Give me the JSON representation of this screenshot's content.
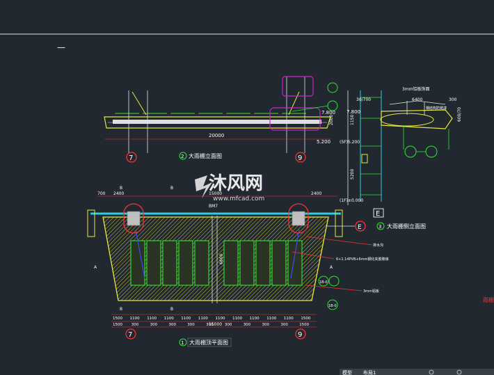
{
  "header": {
    "cursor_mark": "—"
  },
  "plan_view": {
    "caption_number": "1",
    "caption": "大雨棚顶平面图",
    "axis_left": "7",
    "axis_right": "9",
    "dim_left_top": "700",
    "dim_left_top2": "2400",
    "dim_center_top": "15000",
    "dim_right_top": "2400",
    "section_mark_b": "B",
    "section_mark_a": "A",
    "beam_label": "BM7",
    "dims_bottom": [
      "1500",
      "1100",
      "1100",
      "1100",
      "1100",
      "1100",
      "1100",
      "1100",
      "1100",
      "1100",
      "1100",
      "1500"
    ],
    "dims_bottom2": [
      "1500",
      "300",
      "300",
      "300",
      "300",
      "300",
      "300",
      "300",
      "300",
      "300",
      "1500"
    ],
    "total_bottom": "15000",
    "note_glass": "6+1.14PVB+6mm钢化夹胶玻璃",
    "note_panel": "3mm铝板",
    "note_drain": "排水沟",
    "red_note": "雨棚",
    "dim_height": "6600",
    "callout_top": "1B-0",
    "callout_bottom": "1B-0"
  },
  "elevation_view": {
    "caption_number": "2",
    "caption": "大雨棚立面图",
    "axis_left": "7",
    "axis_right": "9",
    "dim_total": "20000",
    "level_top": "7.800",
    "level_bottom": "5.200",
    "dim_side": "2000"
  },
  "side_view": {
    "caption_number": "3",
    "caption": "大雨棚侧立面图",
    "axis": "E",
    "level_top": "7.800",
    "level_mid": "(5F)5.200",
    "level_bottom": "(1F)±0.000",
    "note_top": "3mm铝板饰面",
    "note_mid": "钢结构防锈漆",
    "dim_a": "6400",
    "dim_b": "300",
    "dim_c": "30/700",
    "dim_d": "1150",
    "dim_e": "5200",
    "dim_f": "600/70"
  },
  "watermark": {
    "text": "沐风网",
    "url": "www.mfcad.com"
  },
  "status_bar": {
    "left": "模型",
    "middle": "布局1"
  },
  "colors": {
    "background": "#212830",
    "yellow": "#e8e840",
    "green": "#2ee82e",
    "magenta": "#d020d0",
    "red": "#ff3030",
    "cyan": "#28d0e0"
  }
}
